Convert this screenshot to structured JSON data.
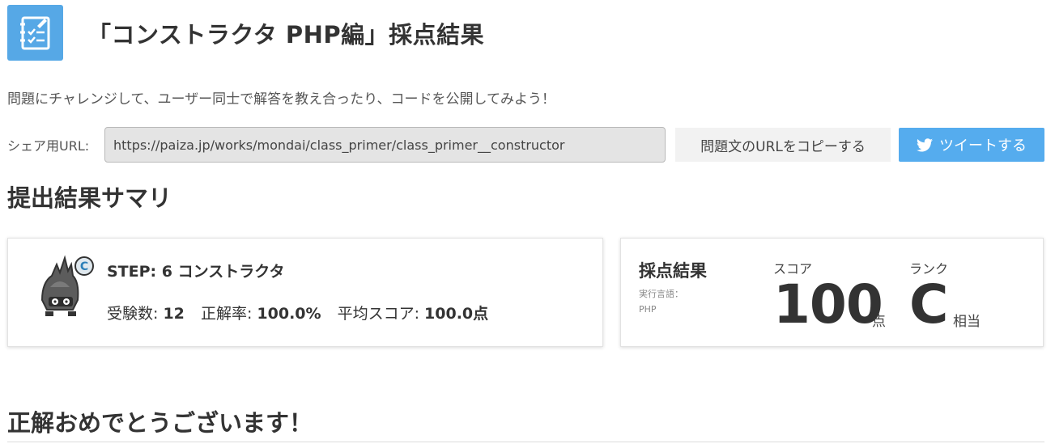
{
  "header": {
    "icon": "checklist-notebook-icon",
    "title": "「コンストラクタ PHP編」採点結果"
  },
  "intro_text": "問題にチャレンジして、ユーザー同士で解答を教え合ったり、コードを公開してみよう！",
  "share": {
    "label": "シェア用URL:",
    "url": "https://paiza.jp/works/mondai/class_primer/class_primer__constructor",
    "copy_button": "問題文のURLをコピーする",
    "tweet_button": "ツイートする",
    "tweet_color": "#55acee"
  },
  "summary_title": "提出結果サマリ",
  "step_card": {
    "icon": "monster-rank-c-icon",
    "title": "STEP: 6 コンストラクタ",
    "examinees_label": "受験数:",
    "examinees_value": "12",
    "accuracy_label": "正解率:",
    "accuracy_value": "100.0%",
    "avg_label": "平均スコア:",
    "avg_value": "100.0点"
  },
  "score_card": {
    "heading": "採点結果",
    "language_label": "実行言語：",
    "language_value": "PHP",
    "score_label": "スコア",
    "score_value": "100",
    "score_unit": "点",
    "rank_label": "ランク",
    "rank_value": "C",
    "rank_unit": "相当"
  },
  "congrats": "正解おめでとうございます！",
  "colors": {
    "accent": "#56a8e6"
  }
}
